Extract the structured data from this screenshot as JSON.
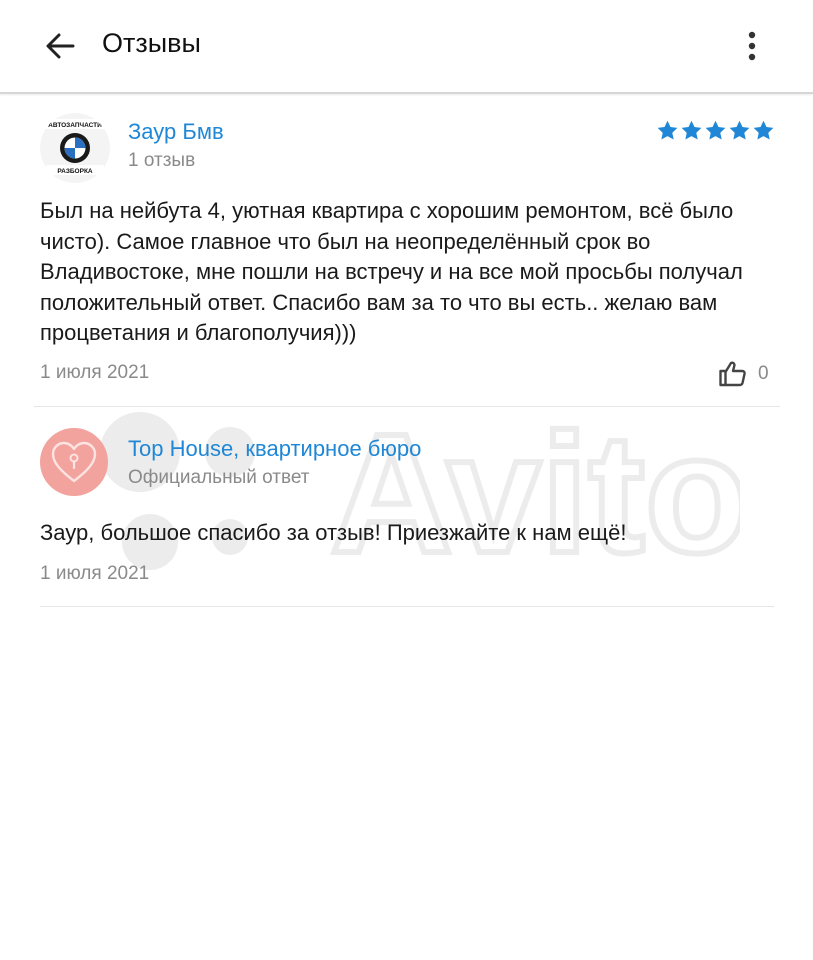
{
  "header": {
    "title": "Отзывы",
    "back_icon": "arrow-left-icon",
    "more_icon": "more-vertical-icon"
  },
  "review": {
    "author": "Заур Бмв",
    "reviews_count": "1 отзыв",
    "avatar_text_top": "АВТОЗАПЧАСТИ",
    "avatar_text_bottom": "РАЗБОРКА",
    "rating": 5,
    "rating_max": 5,
    "text": "Был на нейбута 4, уютная квартира с хорошим ремонтом, всё было чисто). Самое главное что был на неопределённый срок во Владивостоке, мне пошли на встречу и на все мой просьбы получал положительный ответ. Спасибо вам за то что вы есть.. желаю вам процветания и благополучия)))",
    "date": "1 июля 2021",
    "likes": "0"
  },
  "reply": {
    "author": "Top House, квартирное бюро",
    "label": "Официальный ответ",
    "text": "Заур, большое спасибо за отзыв! Приезжайте к нам ещё!",
    "date": "1 июля 2021"
  },
  "watermark": {
    "text": "Avito"
  },
  "colors": {
    "link": "#1f87d5",
    "star": "#1f87d5",
    "muted": "#8a8a8a",
    "reply_avatar": "#f2a39d"
  }
}
